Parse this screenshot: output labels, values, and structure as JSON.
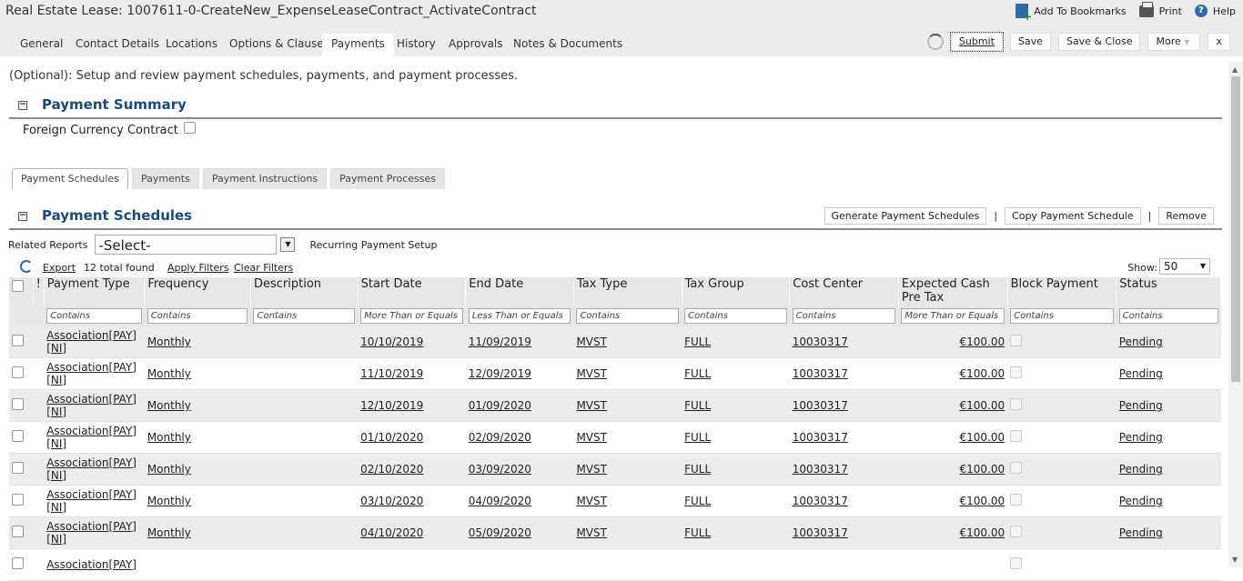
{
  "window": {
    "title": "Real Estate Lease: 1007611-0-CreateNew_ExpenseLeaseContract_ActivateContract"
  },
  "topbar": {
    "bookmarks": "Add To Bookmarks",
    "print": "Print",
    "help": "Help"
  },
  "tabs": [
    "General",
    "Contact Details",
    "Locations",
    "Options & Clauses",
    "Payments",
    "History",
    "Approvals",
    "Notes & Documents"
  ],
  "actions": {
    "submit": "Submit",
    "save": "Save",
    "save_close": "Save & Close",
    "more": "More",
    "close": "x"
  },
  "description": "(Optional): Setup and review payment schedules, payments, and payment processes.",
  "payment_summary": {
    "title": "Payment Summary",
    "foreign_currency": "Foreign Currency Contract"
  },
  "subtabs": [
    "Payment Schedules",
    "Payments",
    "Payment Instructions",
    "Payment Processes"
  ],
  "schedules": {
    "title": "Payment Schedules",
    "generate": "Generate Payment Schedules",
    "copy": "Copy Payment Schedule",
    "remove": "Remove",
    "related_reports": "Related Reports",
    "select": "-Select-",
    "recurring": "Recurring Payment Setup",
    "export": "Export",
    "total": "12 total found",
    "apply": "Apply Filters",
    "clear": "Clear Filters",
    "show_label": "Show:",
    "show_value": "50"
  },
  "columns": [
    "!",
    "Payment Type",
    "Frequency",
    "Description",
    "Start Date",
    "End Date",
    "Tax Type",
    "Tax Group",
    "Cost Center",
    "Expected Cash Pre Tax",
    "Block Payment",
    "Status"
  ],
  "filters": [
    "Contains",
    "Contains",
    "Contains",
    "More Than or Equals",
    "Less Than or Equals",
    "Contains",
    "Contains",
    "Contains",
    "More Than or Equals",
    "Contains",
    "Contains"
  ],
  "rows": [
    {
      "type": "Association[PAY][NI]",
      "freq": "Monthly",
      "desc": "",
      "start": "10/10/2019",
      "end": "11/09/2019",
      "tax": "MVST",
      "group": "FULL",
      "cc": "10030317",
      "amt": "€100.00",
      "status": "Pending"
    },
    {
      "type": "Association[PAY][NI]",
      "freq": "Monthly",
      "desc": "",
      "start": "11/10/2019",
      "end": "12/09/2019",
      "tax": "MVST",
      "group": "FULL",
      "cc": "10030317",
      "amt": "€100.00",
      "status": "Pending"
    },
    {
      "type": "Association[PAY][NI]",
      "freq": "Monthly",
      "desc": "",
      "start": "12/10/2019",
      "end": "01/09/2020",
      "tax": "MVST",
      "group": "FULL",
      "cc": "10030317",
      "amt": "€100.00",
      "status": "Pending"
    },
    {
      "type": "Association[PAY][NI]",
      "freq": "Monthly",
      "desc": "",
      "start": "01/10/2020",
      "end": "02/09/2020",
      "tax": "MVST",
      "group": "FULL",
      "cc": "10030317",
      "amt": "€100.00",
      "status": "Pending"
    },
    {
      "type": "Association[PAY][NI]",
      "freq": "Monthly",
      "desc": "",
      "start": "02/10/2020",
      "end": "03/09/2020",
      "tax": "MVST",
      "group": "FULL",
      "cc": "10030317",
      "amt": "€100.00",
      "status": "Pending"
    },
    {
      "type": "Association[PAY][NI]",
      "freq": "Monthly",
      "desc": "",
      "start": "03/10/2020",
      "end": "04/09/2020",
      "tax": "MVST",
      "group": "FULL",
      "cc": "10030317",
      "amt": "€100.00",
      "status": "Pending"
    },
    {
      "type": "Association[PAY][NI]",
      "freq": "Monthly",
      "desc": "",
      "start": "04/10/2020",
      "end": "05/09/2020",
      "tax": "MVST",
      "group": "FULL",
      "cc": "10030317",
      "amt": "€100.00",
      "status": "Pending"
    },
    {
      "type": "Association[PAY]",
      "freq": "",
      "desc": "",
      "start": "",
      "end": "",
      "tax": "",
      "group": "",
      "cc": "",
      "amt": "",
      "status": ""
    }
  ]
}
